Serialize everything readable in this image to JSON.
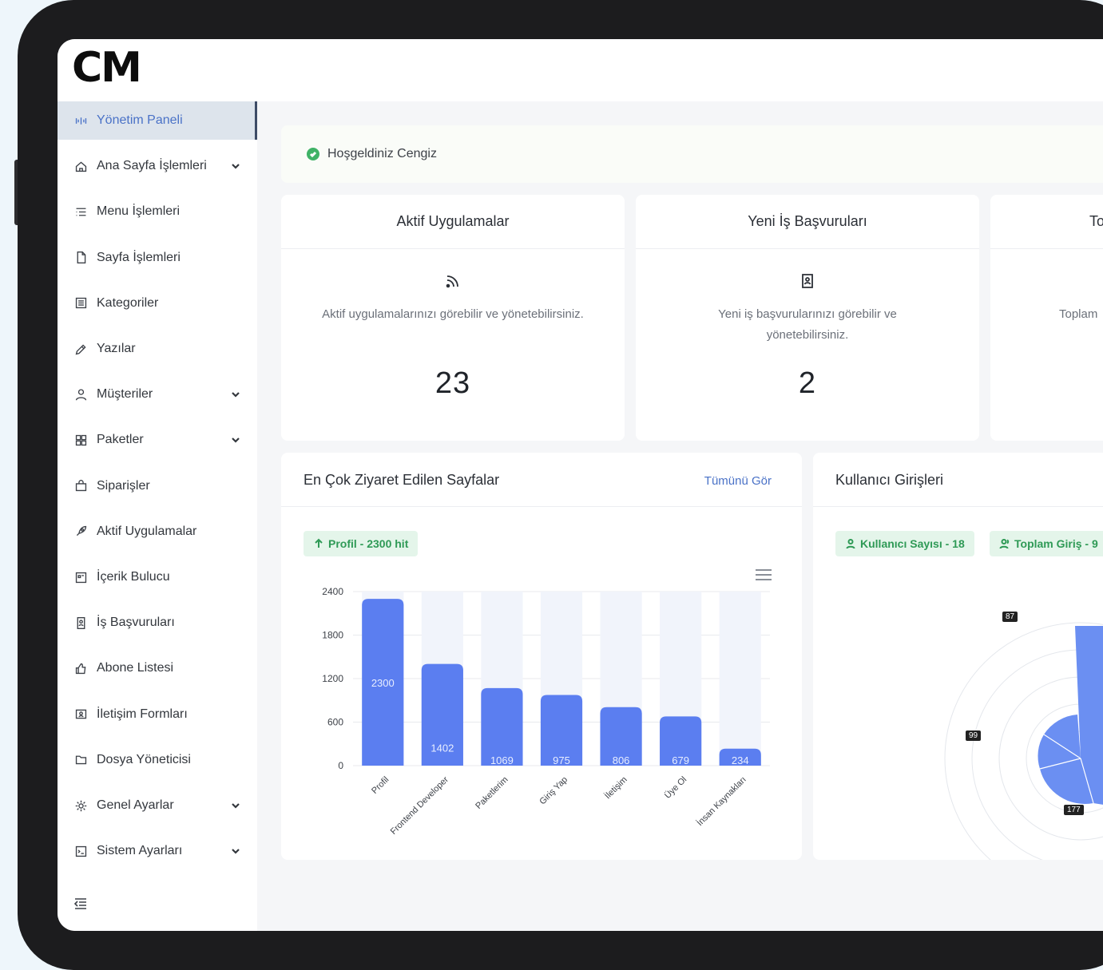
{
  "logo": {
    "text": "CM"
  },
  "sidebar": {
    "items": [
      {
        "label": "Yönetim Paneli",
        "icon": "dashboard-icon",
        "active": true,
        "expandable": false
      },
      {
        "label": "Ana Sayfa İşlemleri",
        "icon": "home-icon",
        "expandable": true
      },
      {
        "label": "Menu İşlemleri",
        "icon": "menu-list-icon",
        "expandable": false
      },
      {
        "label": "Sayfa İşlemleri",
        "icon": "page-icon",
        "expandable": false
      },
      {
        "label": "Kategoriler",
        "icon": "category-icon",
        "expandable": false
      },
      {
        "label": "Yazılar",
        "icon": "pen-icon",
        "expandable": false
      },
      {
        "label": "Müşteriler",
        "icon": "user-icon",
        "expandable": true
      },
      {
        "label": "Paketler",
        "icon": "package-icon",
        "expandable": true
      },
      {
        "label": "Siparişler",
        "icon": "bag-icon",
        "expandable": false
      },
      {
        "label": "Aktif Uygulamalar",
        "icon": "rocket-icon",
        "expandable": false
      },
      {
        "label": "İçerik Bulucu",
        "icon": "content-finder-icon",
        "expandable": false
      },
      {
        "label": "İş Başvuruları",
        "icon": "application-icon",
        "expandable": false
      },
      {
        "label": "Abone Listesi",
        "icon": "thumbs-up-icon",
        "expandable": false
      },
      {
        "label": "İletişim Formları",
        "icon": "contact-form-icon",
        "expandable": false
      },
      {
        "label": "Dosya Yöneticisi",
        "icon": "folder-icon",
        "expandable": false
      },
      {
        "label": "Genel Ayarlar",
        "icon": "gear-icon",
        "expandable": true
      },
      {
        "label": "Sistem Ayarları",
        "icon": "terminal-icon",
        "expandable": true
      }
    ]
  },
  "welcome": {
    "text": "Hoşgeldiniz Cengiz"
  },
  "stats": [
    {
      "title": "Aktif Uygulamalar",
      "icon": "rss-icon",
      "desc": "Aktif uygulamalarınızı görebilir ve yönetebilirsiniz.",
      "value": "23"
    },
    {
      "title": "Yeni İş Başvuruları",
      "icon": "document-user-icon",
      "desc": "Yeni iş başvurularınızı görebilir ve yönetebilirsiniz.",
      "value": "2"
    },
    {
      "title": "To",
      "icon": "",
      "desc": "Toplam",
      "value": ""
    }
  ],
  "pages_panel": {
    "title": "En Çok Ziyaret Edilen Sayfalar",
    "link": "Tümünü Gör",
    "pill": "Profil - 2300 hit"
  },
  "logins_panel": {
    "title": "Kullanıcı Girişleri",
    "pills": [
      "Kullanıcı Sayısı - 18",
      "Toplam Giriş - 9"
    ],
    "polar_labels": [
      "87",
      "99",
      "177"
    ]
  },
  "chart_data": {
    "type": "bar",
    "categories": [
      "Profil",
      "Frontend Developer",
      "Paketlerim",
      "Giriş Yap",
      "İletişim",
      "Üye Ol",
      "İnsan Kaynakları"
    ],
    "values": [
      2300,
      1402,
      1069,
      975,
      806,
      679,
      234
    ],
    "ylim": [
      0,
      2400
    ],
    "yticks": [
      0,
      600,
      1200,
      1800,
      2400
    ],
    "colors": {
      "bar": "#5b7ef0",
      "track": "#f1f4fb"
    }
  }
}
